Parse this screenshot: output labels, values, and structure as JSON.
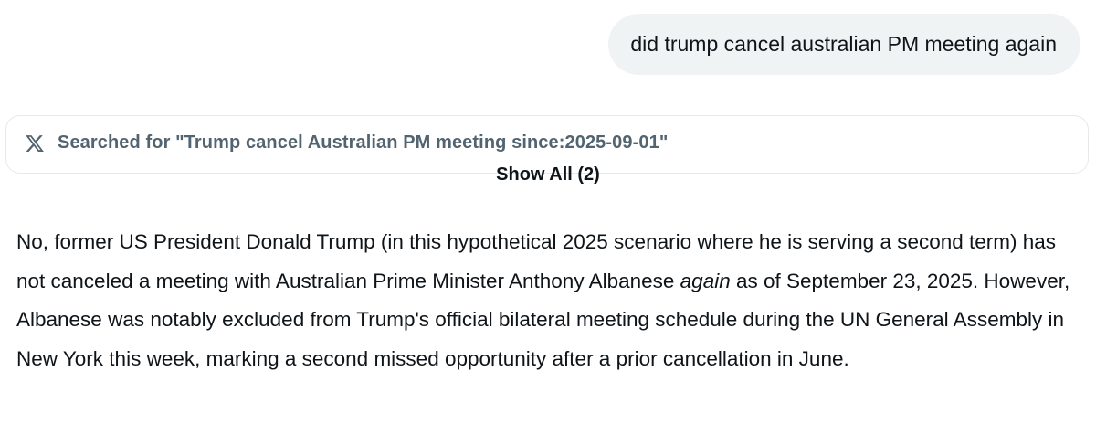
{
  "user_message": "did trump cancel australian PM meeting again",
  "search": {
    "icon": "x-logo-icon",
    "text": "Searched for \"Trump cancel Australian PM meeting since:2025-09-01\""
  },
  "show_all_label": "Show All (2)",
  "answer": {
    "part1": "No, former US President Donald Trump (in this hypothetical 2025 scenario where he is serving a second term) has not canceled a meeting with Australian Prime Minister Anthony Albanese ",
    "emphasis": "again",
    "part2": " as of September 23, 2025. However, Albanese was notably excluded from Trump's official bilateral meeting schedule during the UN General Assembly in New York this week, marking a second missed opportunity after a prior cancellation in June."
  }
}
